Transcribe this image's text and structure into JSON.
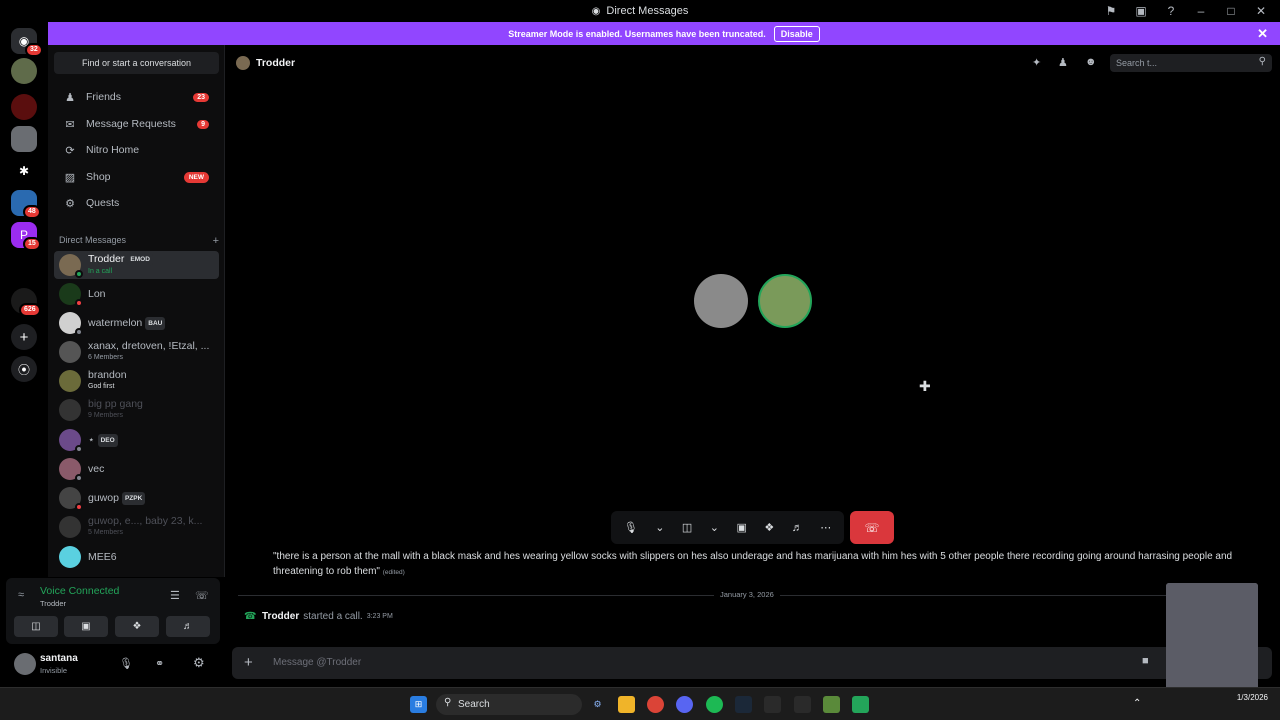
{
  "window": {
    "title": "Direct Messages"
  },
  "banner": {
    "text": "Streamer Mode is enabled. Usernames have been truncated.",
    "disable_label": "Disable"
  },
  "servers": [
    {
      "badge": "32"
    },
    {
      "badge": ""
    },
    {
      "badge": ""
    },
    {
      "badge": ""
    },
    {
      "badge": ""
    },
    {
      "badge": "48"
    },
    {
      "badge": "15"
    },
    {
      "badge": "626"
    }
  ],
  "sidebar": {
    "find_placeholder": "Find or start a conversation",
    "nav": [
      {
        "label": "Friends",
        "count": "23",
        "icon": "friends-icon"
      },
      {
        "label": "Message Requests",
        "count": "9",
        "icon": "mail-icon"
      },
      {
        "label": "Nitro Home",
        "count": "",
        "icon": "nitro-icon"
      },
      {
        "label": "Shop",
        "count": "NEW",
        "icon": "shop-icon"
      },
      {
        "label": "Quests",
        "count": "",
        "icon": "quests-icon"
      }
    ],
    "dm_header": "Direct Messages",
    "dms": [
      {
        "name": "Trodder",
        "tag": "EMOD",
        "sub": "In a call",
        "color": "#7a6a52",
        "status": "#23a55a"
      },
      {
        "name": "Lon",
        "tag": "",
        "sub": "",
        "color": "#1a3a1a",
        "status": "#f23f43"
      },
      {
        "name": "watermelon",
        "tag": "BAU",
        "sub": "",
        "color": "#d0d0d0",
        "status": "#80848e"
      },
      {
        "name": "xanax, dretoven, !Etzal, ...",
        "tag": "",
        "sub": "6 Members",
        "color": "#555",
        "status": ""
      },
      {
        "name": "brandon",
        "tag": "",
        "sub": "God first",
        "color": "#6b6b3a",
        "status": ""
      },
      {
        "name": "big pp gang",
        "tag": "",
        "sub": "9 Members",
        "color": "#333",
        "status": ""
      },
      {
        "name": "⋆",
        "tag": "DEO",
        "sub": "",
        "color": "#6b4a8a",
        "status": "#80848e"
      },
      {
        "name": "vec",
        "tag": "",
        "sub": "",
        "color": "#8a5a6a",
        "status": "#80848e"
      },
      {
        "name": "guwop",
        "tag": "PZPK",
        "sub": "",
        "color": "#444",
        "status": "#f23f43"
      },
      {
        "name": "guwop, e..., baby 23, k...",
        "tag": "",
        "sub": "5 Members",
        "color": "#333",
        "status": ""
      },
      {
        "name": "MEE6",
        "tag": "",
        "sub": "",
        "color": "#5ad0e0",
        "status": ""
      }
    ]
  },
  "voice": {
    "status": "Voice Connected",
    "channel": "Trodder"
  },
  "user": {
    "name": "santana",
    "status": "Invisible"
  },
  "header": {
    "name": "Trodder",
    "search_placeholder": "Search t..."
  },
  "messages": {
    "quote_line1": "\"there is a person at the mall with a black mask and hes wearing yellow socks with slippers on hes also underage and has marijuana with him hes with 5 other people there recording going around harrasing people and",
    "quote_line2": "threatening to rob them\"",
    "edited": "(edited)",
    "date_divider": "January 3, 2026",
    "call_user": "Trodder",
    "call_text": "started a call.",
    "call_time": "3:23 PM"
  },
  "composer": {
    "placeholder": "Message @Trodder"
  },
  "taskbar": {
    "search_label": "Search",
    "date": "1/3/2026"
  },
  "colors": {
    "banner": "#9146ff",
    "voice_green": "#23a55a",
    "hangup": "#da373c"
  }
}
